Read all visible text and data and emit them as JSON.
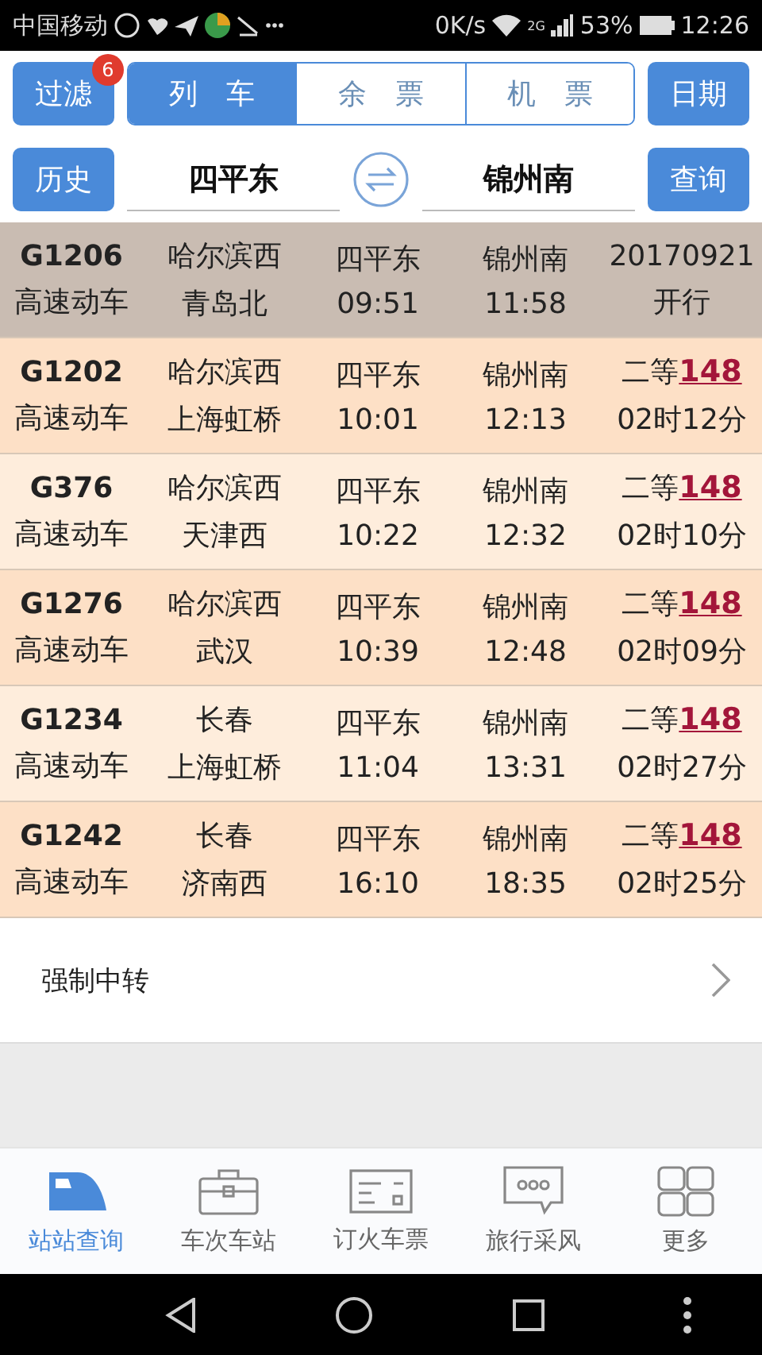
{
  "status_bar": {
    "carrier": "中国移动",
    "speed": "0K/s",
    "network": "2G",
    "battery": "53%",
    "time": "12:26"
  },
  "toolbar": {
    "filter": {
      "label": "过滤",
      "badge": "6"
    },
    "modes": [
      {
        "label": "列　车",
        "selected": true
      },
      {
        "label": "余　票",
        "selected": false
      },
      {
        "label": "机　票",
        "selected": false
      }
    ],
    "date_button": "日期"
  },
  "route": {
    "history_button": "历史",
    "from": "四平东",
    "to": "锦州南",
    "query_button": "查询"
  },
  "trains": [
    {
      "kind": "date",
      "selected": true,
      "code": "G1206",
      "type": "高速动车",
      "origin": "哈尔滨西",
      "terminal": "青岛北",
      "depart_station": "四平东",
      "depart_time": "09:51",
      "arrive_station": "锦州南",
      "arrive_time": "11:58",
      "info": "20170921",
      "info_2": "开行"
    },
    {
      "kind": "price",
      "selected": false,
      "code": "G1202",
      "type": "高速动车",
      "origin": "哈尔滨西",
      "terminal": "上海虹桥",
      "depart_station": "四平东",
      "depart_time": "10:01",
      "arrive_station": "锦州南",
      "arrive_time": "12:13",
      "info": "二等",
      "price": "148",
      "info_2": "02时12分"
    },
    {
      "kind": "price",
      "selected": false,
      "code": "G376",
      "type": "高速动车",
      "origin": "哈尔滨西",
      "terminal": "天津西",
      "depart_station": "四平东",
      "depart_time": "10:22",
      "arrive_station": "锦州南",
      "arrive_time": "12:32",
      "info": "二等",
      "price": "148",
      "info_2": "02时10分"
    },
    {
      "kind": "price",
      "selected": false,
      "code": "G1276",
      "type": "高速动车",
      "origin": "哈尔滨西",
      "terminal": "武汉",
      "depart_station": "四平东",
      "depart_time": "10:39",
      "arrive_station": "锦州南",
      "arrive_time": "12:48",
      "info": "二等",
      "price": "148",
      "info_2": "02时09分"
    },
    {
      "kind": "price",
      "selected": false,
      "code": "G1234",
      "type": "高速动车",
      "origin": "长春",
      "terminal": "上海虹桥",
      "depart_station": "四平东",
      "depart_time": "11:04",
      "arrive_station": "锦州南",
      "arrive_time": "13:31",
      "info": "二等",
      "price": "148",
      "info_2": "02时27分"
    },
    {
      "kind": "price",
      "selected": false,
      "code": "G1242",
      "type": "高速动车",
      "origin": "长春",
      "terminal": "济南西",
      "depart_station": "四平东",
      "depart_time": "16:10",
      "arrive_station": "锦州南",
      "arrive_time": "18:35",
      "info": "二等",
      "price": "148",
      "info_2": "02时25分"
    }
  ],
  "transfer_link": "强制中转",
  "tab_bar": [
    {
      "label": "站站查询",
      "kind": "train",
      "selected": true
    },
    {
      "label": "车次车站",
      "kind": "case",
      "selected": false
    },
    {
      "label": "订火车票",
      "kind": "ticket",
      "selected": false
    },
    {
      "label": "旅行采风",
      "kind": "chat",
      "selected": false
    },
    {
      "label": "更多",
      "kind": "grid",
      "selected": false
    }
  ]
}
